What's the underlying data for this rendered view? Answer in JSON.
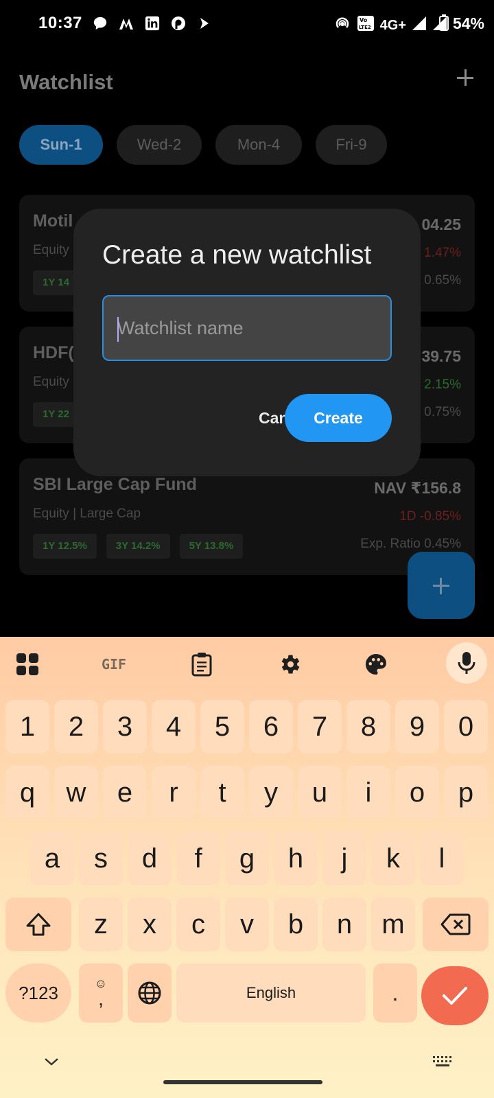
{
  "status_bar": {
    "time": "10:37",
    "network": "4G+",
    "battery": "54%"
  },
  "header": {
    "title": "Watchlist",
    "add_icon": "plus-icon"
  },
  "tabs": [
    {
      "label": "Sun-1",
      "active": true
    },
    {
      "label": "Wed-2",
      "active": false
    },
    {
      "label": "Mon-4",
      "active": false
    },
    {
      "label": "Fri-9",
      "active": false
    }
  ],
  "funds": [
    {
      "name": "Motil",
      "category": "Equity",
      "returns": [
        "1Y 14"
      ],
      "nav": "04.25",
      "change": "1.47%",
      "exp_ratio": "0.65%"
    },
    {
      "name": "HDF(",
      "category": "Equity",
      "returns": [
        "1Y 22"
      ],
      "nav": "39.75",
      "change": "2.15%",
      "exp_ratio": "0.75%"
    },
    {
      "name": "SBI Large Cap Fund",
      "category": "Equity | Large Cap",
      "returns": [
        "1Y 12.5%",
        "3Y 14.2%",
        "5Y 13.8%"
      ],
      "nav": "NAV ₹156.8",
      "change": "1D -0.85%",
      "exp_ratio": "Exp. Ratio 0.45%"
    }
  ],
  "dialog": {
    "title": "Create a new watchlist",
    "input_value": "",
    "input_placeholder": "Watchlist name",
    "cancel_label": "Cancel",
    "create_label": "Create"
  },
  "keyboard": {
    "toolbar": [
      "apps-grid-icon",
      "gif-icon",
      "clipboard-icon",
      "settings-gear-icon",
      "palette-icon",
      "microphone-icon"
    ],
    "gif_label": "GIF",
    "row_numbers": [
      "1",
      "2",
      "3",
      "4",
      "5",
      "6",
      "7",
      "8",
      "9",
      "0"
    ],
    "row1": [
      "q",
      "w",
      "e",
      "r",
      "t",
      "y",
      "u",
      "i",
      "o",
      "p"
    ],
    "row2": [
      "a",
      "s",
      "d",
      "f",
      "g",
      "h",
      "j",
      "k",
      "l"
    ],
    "row3": [
      "z",
      "x",
      "c",
      "v",
      "b",
      "n",
      "m"
    ],
    "symbols_label": "?123",
    "emoji_comma": ",",
    "space_label": "English",
    "period": "."
  }
}
